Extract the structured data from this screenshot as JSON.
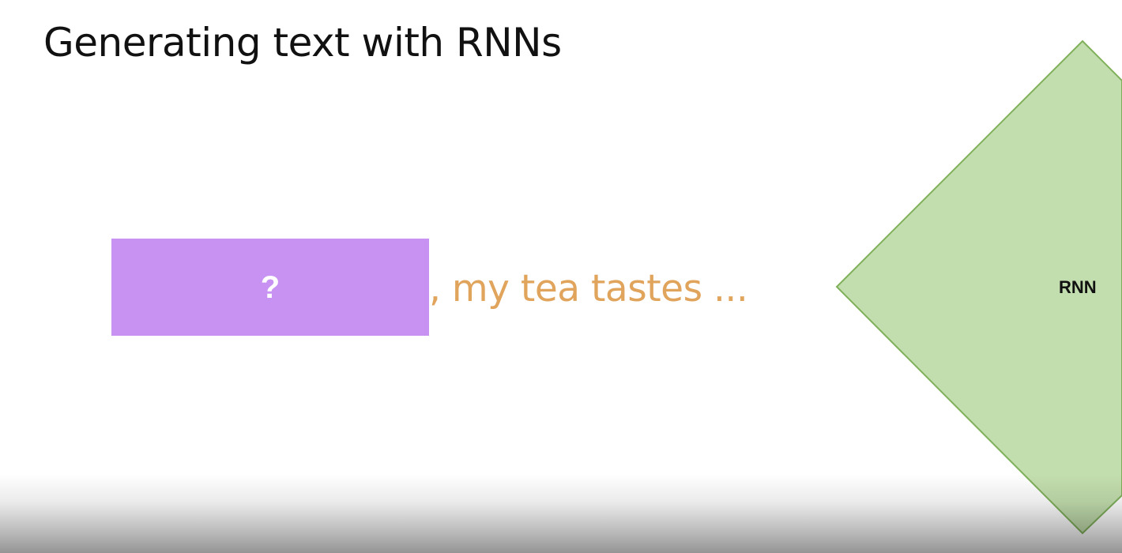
{
  "slide": {
    "title": "Generating text with RNNs",
    "masked_word": "?",
    "sentence_continuation": ", my tea tastes  ...",
    "model_label": "RNN"
  },
  "colors": {
    "mask_fill": "#c792f2",
    "sentence_text": "#e0a45c",
    "rnn_fill": "#c3deae",
    "rnn_stroke": "#7fb05a",
    "title_text": "#111111"
  }
}
